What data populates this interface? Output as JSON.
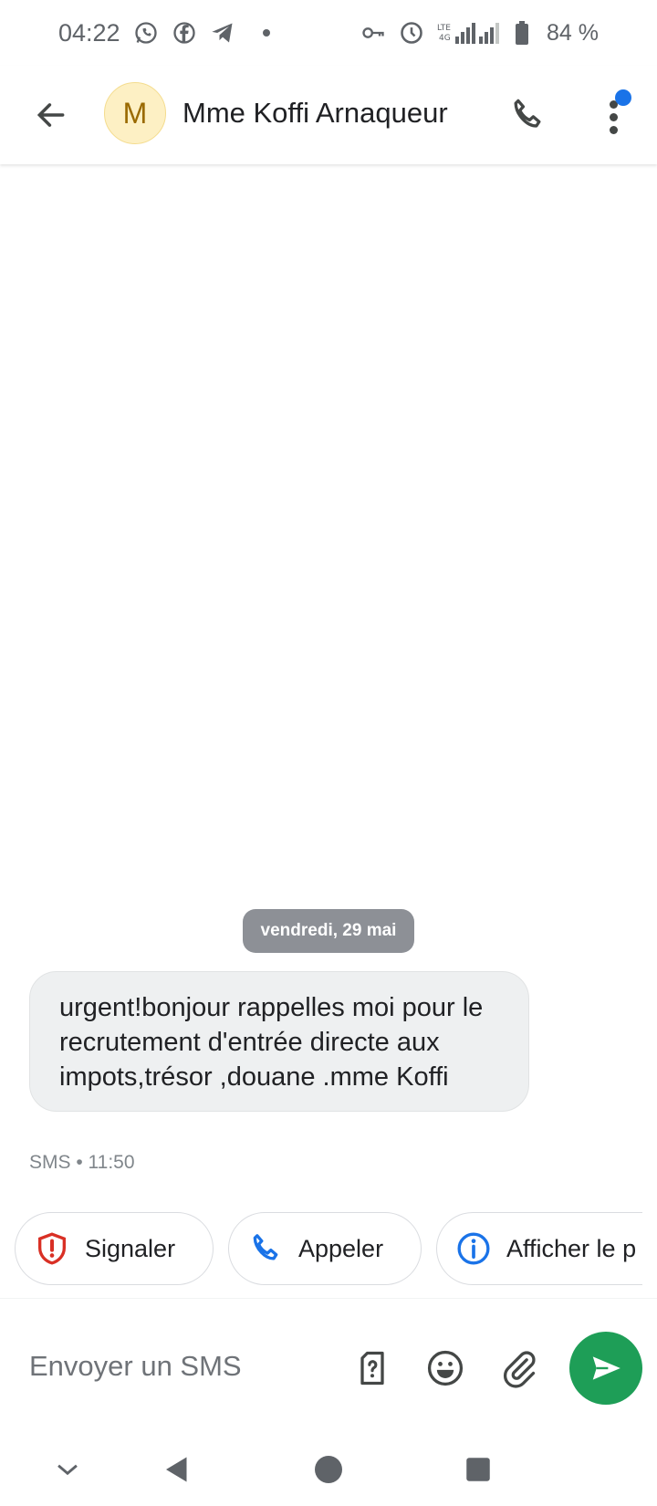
{
  "status_bar": {
    "time": "04:22",
    "battery": "84 %",
    "icons": [
      "whatsapp-icon",
      "facebook-icon",
      "telegram-icon",
      "dot",
      "vpn-key-icon",
      "alarm-icon",
      "lte-icon",
      "signal-icon",
      "signal-icon",
      "battery-icon"
    ]
  },
  "app_bar": {
    "avatar_letter": "M",
    "contact_name": "Mme Koffi Arnaqueur",
    "accent": "#1a73e8"
  },
  "conversation": {
    "date_separator": "vendredi, 29 mai",
    "message_text": "urgent!bonjour rappelles moi pour le recrutement d'entrée directe aux impots,trésor ,douane .mme Koffi",
    "message_meta": "SMS • 11:50"
  },
  "suggestions": {
    "report": "Signaler",
    "call": "Appeler",
    "info": "Afficher le p"
  },
  "compose": {
    "placeholder": "Envoyer un SMS",
    "send_color": "#1e9e57"
  }
}
